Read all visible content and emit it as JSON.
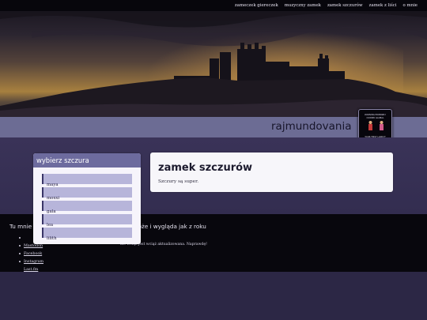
{
  "nav": {
    "items": [
      {
        "label": "zameczek giereczek"
      },
      {
        "label": "muzyczny zamek"
      },
      {
        "label": "zamek szczurów"
      },
      {
        "label": "zamek z liści"
      },
      {
        "label": "o mnie"
      }
    ]
  },
  "header": {
    "site_title": "rajmundovania",
    "badge_lines": [
      "WARNING PROBABLY",
      "CURSED GLOBAL",
      "",
      "",
      "",
      "",
      "YOUR FIRST LAND IT"
    ]
  },
  "sidebar": {
    "title": "wybierz szczura",
    "items": [
      {
        "label": "maya"
      },
      {
        "label": "moxxi"
      },
      {
        "label": "gala"
      },
      {
        "label": "lea"
      },
      {
        "label": "lilith"
      }
    ]
  },
  "main": {
    "title": "zamek szczurów",
    "body": "Szczury są super."
  },
  "footer": {
    "heading": "Tu mnie",
    "links": [
      {
        "label": "Mastodon"
      },
      {
        "label": "Facebook"
      },
      {
        "label": "Instagram"
      },
      {
        "label": "Last.fm"
      }
    ],
    "mid_text": "ona może i wygląda jak z roku",
    "small_text": "ale wciąż jest wciąż aktualizowana. Naprawdę!"
  },
  "colors": {
    "nav_bg": "#07060c",
    "banner": "#6c6c94",
    "sidebar_header": "#6d6b9e",
    "sidebar_item": "#b7b5da",
    "page_band": "#3a3358"
  }
}
